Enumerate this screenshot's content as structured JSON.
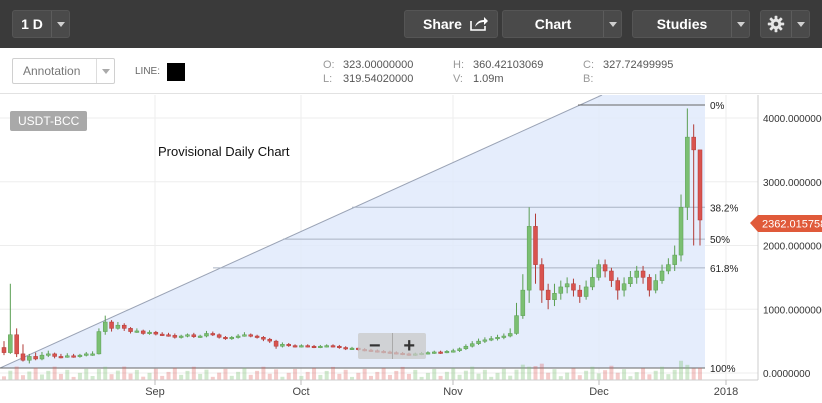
{
  "toolbar": {
    "interval": "1 D",
    "share": "Share",
    "chart": "Chart",
    "studies": "Studies"
  },
  "annotation_bar": {
    "annotation_select": "Annotation",
    "line_label": "LINE:",
    "ohlc": {
      "open_key": "O:",
      "open": "323.00000000",
      "low_key": "L:",
      "low": "319.54020000",
      "high_key": "H:",
      "high": "360.42103069",
      "volume_key": "V:",
      "volume": "1.09m",
      "close_key": "C:",
      "close": "327.72499995",
      "b_key": "B:",
      "b": ""
    }
  },
  "symbol": "USDT-BCC",
  "chart_title": "Provisional Daily Chart",
  "zoom": {
    "minus": "−",
    "plus": "+"
  },
  "colors": {
    "up": "#7bbf72",
    "down": "#d9534f",
    "fib_fill": "#dfe8fb",
    "price_tag": "#e05a3a"
  },
  "chart_data": {
    "type": "candlestick",
    "x_ticks": [
      "Sep",
      "Oct",
      "Nov",
      "Dec",
      "2018"
    ],
    "y_ticks": [
      "4000.0000000",
      "3000.0000000",
      "2000.0000000",
      "1000.0000000",
      "0.0000000"
    ],
    "ylim": [
      0,
      4200
    ],
    "current_price": "2362.0157585",
    "fib_levels": [
      {
        "label": "0%",
        "value": 4150
      },
      {
        "label": "38.2%",
        "value": 2600
      },
      {
        "label": "50%",
        "value": 2100
      },
      {
        "label": "61.8%",
        "value": 1650
      },
      {
        "label": "100%",
        "value": 100
      }
    ],
    "candles": [
      [
        400,
        320,
        500,
        280
      ],
      [
        320,
        600,
        1400,
        300
      ],
      [
        600,
        300,
        700,
        250
      ],
      [
        300,
        200,
        450,
        180
      ],
      [
        200,
        260,
        300,
        150
      ],
      [
        260,
        220,
        320,
        200
      ],
      [
        220,
        280,
        330,
        200
      ],
      [
        280,
        300,
        350,
        250
      ],
      [
        300,
        260,
        320,
        230
      ],
      [
        260,
        250,
        300,
        230
      ],
      [
        250,
        270,
        310,
        240
      ],
      [
        270,
        260,
        300,
        240
      ],
      [
        260,
        280,
        300,
        240
      ],
      [
        280,
        300,
        330,
        260
      ],
      [
        300,
        300,
        340,
        270
      ],
      [
        300,
        650,
        700,
        290
      ],
      [
        650,
        800,
        900,
        600
      ],
      [
        800,
        700,
        830,
        650
      ],
      [
        700,
        750,
        800,
        680
      ],
      [
        750,
        700,
        780,
        660
      ],
      [
        700,
        650,
        720,
        620
      ],
      [
        650,
        660,
        700,
        630
      ],
      [
        660,
        620,
        680,
        600
      ],
      [
        620,
        640,
        670,
        600
      ],
      [
        640,
        610,
        660,
        590
      ],
      [
        610,
        600,
        640,
        580
      ],
      [
        600,
        590,
        630,
        570
      ],
      [
        590,
        560,
        620,
        540
      ],
      [
        560,
        580,
        600,
        540
      ],
      [
        580,
        600,
        620,
        560
      ],
      [
        600,
        570,
        630,
        550
      ],
      [
        570,
        580,
        600,
        550
      ],
      [
        580,
        620,
        660,
        560
      ],
      [
        620,
        600,
        650,
        580
      ],
      [
        600,
        560,
        620,
        540
      ],
      [
        560,
        540,
        580,
        520
      ],
      [
        540,
        560,
        580,
        520
      ],
      [
        560,
        580,
        610,
        540
      ],
      [
        580,
        600,
        640,
        570
      ],
      [
        600,
        580,
        620,
        560
      ],
      [
        580,
        560,
        600,
        540
      ],
      [
        560,
        530,
        580,
        500
      ],
      [
        530,
        500,
        550,
        470
      ],
      [
        500,
        420,
        520,
        380
      ],
      [
        420,
        450,
        480,
        400
      ],
      [
        450,
        430,
        470,
        410
      ],
      [
        430,
        420,
        450,
        400
      ],
      [
        420,
        430,
        450,
        400
      ],
      [
        430,
        420,
        450,
        400
      ],
      [
        420,
        410,
        440,
        390
      ],
      [
        410,
        420,
        440,
        390
      ],
      [
        420,
        430,
        450,
        400
      ],
      [
        430,
        420,
        450,
        400
      ],
      [
        420,
        400,
        440,
        380
      ],
      [
        400,
        380,
        420,
        360
      ],
      [
        380,
        390,
        410,
        360
      ],
      [
        390,
        370,
        400,
        350
      ],
      [
        370,
        360,
        390,
        340
      ],
      [
        360,
        350,
        380,
        330
      ],
      [
        350,
        340,
        370,
        320
      ],
      [
        340,
        330,
        360,
        310
      ],
      [
        330,
        320,
        350,
        300
      ],
      [
        320,
        310,
        340,
        290
      ],
      [
        310,
        300,
        330,
        280
      ],
      [
        300,
        290,
        320,
        270
      ],
      [
        290,
        300,
        320,
        270
      ],
      [
        300,
        310,
        330,
        280
      ],
      [
        310,
        320,
        340,
        290
      ],
      [
        320,
        330,
        350,
        300
      ],
      [
        330,
        320,
        350,
        300
      ],
      [
        320,
        340,
        360,
        310
      ],
      [
        340,
        350,
        380,
        320
      ],
      [
        350,
        380,
        400,
        330
      ],
      [
        380,
        420,
        450,
        360
      ],
      [
        420,
        460,
        500,
        400
      ],
      [
        460,
        500,
        540,
        440
      ],
      [
        500,
        520,
        560,
        470
      ],
      [
        520,
        540,
        580,
        500
      ],
      [
        540,
        560,
        600,
        510
      ],
      [
        560,
        580,
        620,
        530
      ],
      [
        580,
        620,
        700,
        560
      ],
      [
        620,
        900,
        1100,
        600
      ],
      [
        900,
        1300,
        1550,
        850
      ],
      [
        1300,
        2300,
        2600,
        1100
      ],
      [
        2300,
        1700,
        2500,
        1400
      ],
      [
        1700,
        1300,
        1800,
        1100
      ],
      [
        1300,
        1150,
        1400,
        1000
      ],
      [
        1150,
        1250,
        1400,
        1050
      ],
      [
        1250,
        1350,
        1450,
        1150
      ],
      [
        1350,
        1400,
        1500,
        1250
      ],
      [
        1400,
        1300,
        1480,
        1200
      ],
      [
        1300,
        1200,
        1380,
        1100
      ],
      [
        1200,
        1350,
        1450,
        1150
      ],
      [
        1350,
        1500,
        1650,
        1300
      ],
      [
        1500,
        1700,
        1780,
        1450
      ],
      [
        1700,
        1600,
        1780,
        1500
      ],
      [
        1600,
        1450,
        1650,
        1350
      ],
      [
        1450,
        1300,
        1500,
        1150
      ],
      [
        1300,
        1400,
        1500,
        1200
      ],
      [
        1400,
        1500,
        1600,
        1350
      ],
      [
        1500,
        1600,
        1680,
        1400
      ],
      [
        1600,
        1500,
        1680,
        1400
      ],
      [
        1500,
        1300,
        1550,
        1200
      ],
      [
        1300,
        1450,
        1550,
        1250
      ],
      [
        1450,
        1600,
        1700,
        1400
      ],
      [
        1600,
        1700,
        1800,
        1550
      ],
      [
        1700,
        1850,
        2000,
        1600
      ],
      [
        1850,
        2600,
        2800,
        1750
      ],
      [
        2600,
        3700,
        4150,
        2400
      ],
      [
        3700,
        3500,
        3900,
        2000
      ],
      [
        3500,
        2400,
        3000,
        2000
      ]
    ]
  }
}
